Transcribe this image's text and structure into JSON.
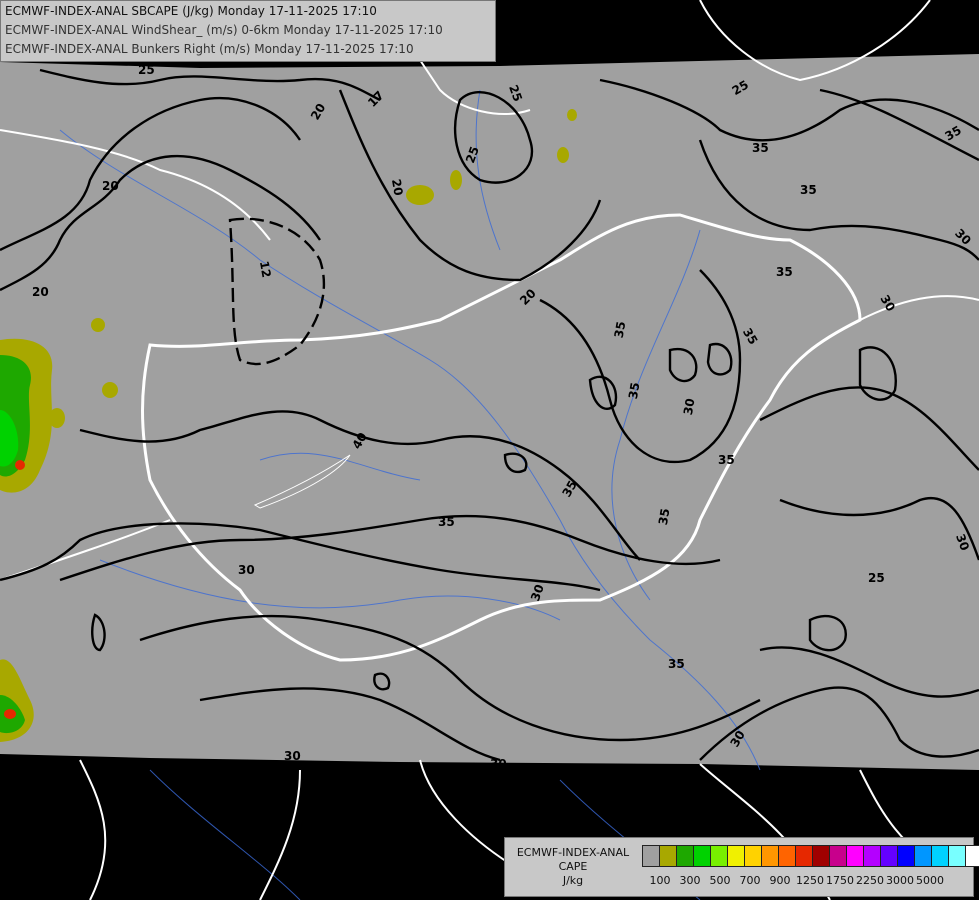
{
  "title_lines": [
    "ECMWF-INDEX-ANAL SBCAPE (J/kg) Monday 17-11-2025 17:10",
    "ECMWF-INDEX-ANAL WindShear_ (m/s) 0-6km Monday 17-11-2025 17:10",
    "ECMWF-INDEX-ANAL Bunkers Right (m/s) Monday 17-11-2025 17:10"
  ],
  "legend": {
    "title_line1": "ECMWF-INDEX-ANAL",
    "title_line2": "CAPE",
    "title_line3": "J/kg",
    "colors": [
      "#a0a0a0",
      "#a8a800",
      "#1ea800",
      "#00d200",
      "#78f000",
      "#f0f000",
      "#ffd200",
      "#ff9600",
      "#ff6400",
      "#e62800",
      "#a00000",
      "#c8008c",
      "#ff00ff",
      "#b400ff",
      "#6400ff",
      "#0000ff",
      "#0096ff",
      "#00d2ff",
      "#78ffff",
      "#ffffff"
    ],
    "tick_labels": [
      "100",
      "300",
      "500",
      "700",
      "900",
      "1250",
      "1750",
      "2250",
      "3000",
      "5000"
    ]
  },
  "contour_labels": [
    "25",
    "20",
    "17",
    "20",
    "25",
    "20",
    "25",
    "25",
    "35",
    "35",
    "30",
    "20",
    "20",
    "12",
    "35",
    "35",
    "35",
    "30",
    "35",
    "35",
    "30",
    "40",
    "35",
    "35",
    "30",
    "30",
    "30",
    "30",
    "30",
    "35",
    "35",
    "35",
    "25",
    "30"
  ],
  "colors": {
    "background": "#000000",
    "data_area": "#a0a0a0",
    "contour": "#000000",
    "border": "#ffffff",
    "river": "#3a6ad8"
  }
}
